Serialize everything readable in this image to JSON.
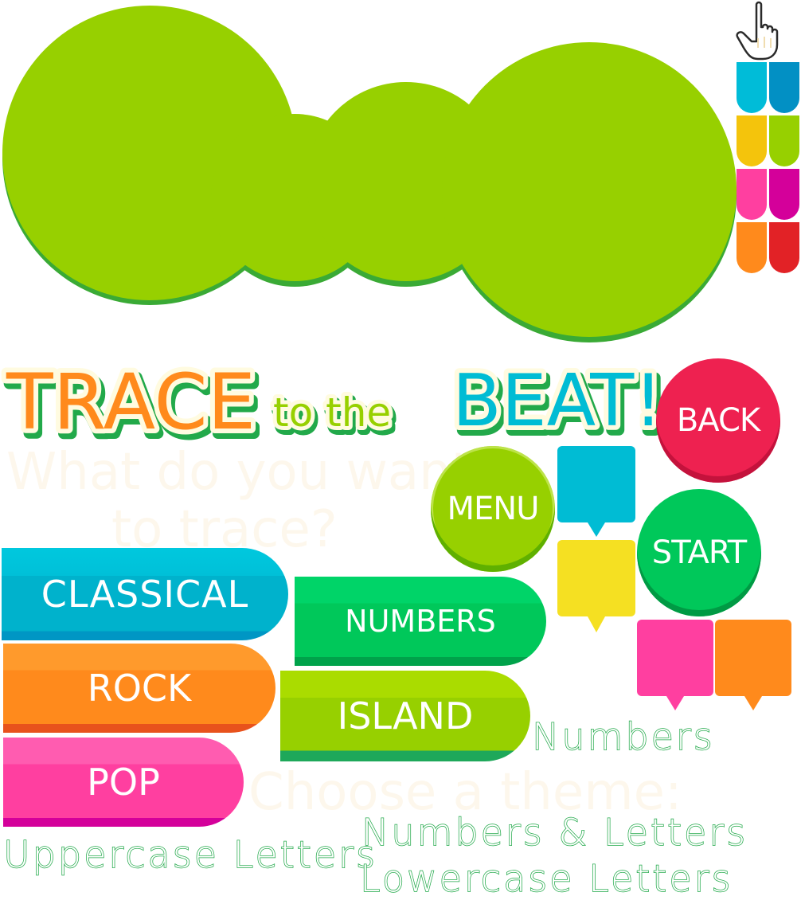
{
  "title": {
    "trace": "TRACE",
    "to_the": "to the",
    "beat": "BEAT!"
  },
  "buttons": {
    "back": "BACK",
    "menu": "MENU",
    "start": "START"
  },
  "themes": {
    "classical": "CLASSICAL",
    "rock": "ROCK",
    "pop": "POP",
    "numbers": "NUMBERS",
    "island": "ISLAND"
  },
  "prompts": {
    "what_line1": "What do you want",
    "what_line2": "to trace?",
    "choose_theme": "Choose a theme:"
  },
  "trace_options": {
    "numbers": "Numbers",
    "numbers_letters": "Numbers & Letters",
    "uppercase": "Uppercase Letters",
    "lowercase": "Lowercase Letters"
  },
  "colors": {
    "green": "#97d000",
    "green_dark": "#3aaa35",
    "orange": "#ff8a1c",
    "red": "#ee2150",
    "blue": "#00bcd4",
    "yellow": "#f5e022",
    "pink": "#ff3fa0",
    "magenta": "#d4009a",
    "emerald": "#00c85a"
  },
  "swatches": [
    "#00bcd8",
    "#0290c4",
    "#f4c40c",
    "#97d000",
    "#ff3fa0",
    "#d4009a",
    "#ff8a1c",
    "#e22226"
  ]
}
